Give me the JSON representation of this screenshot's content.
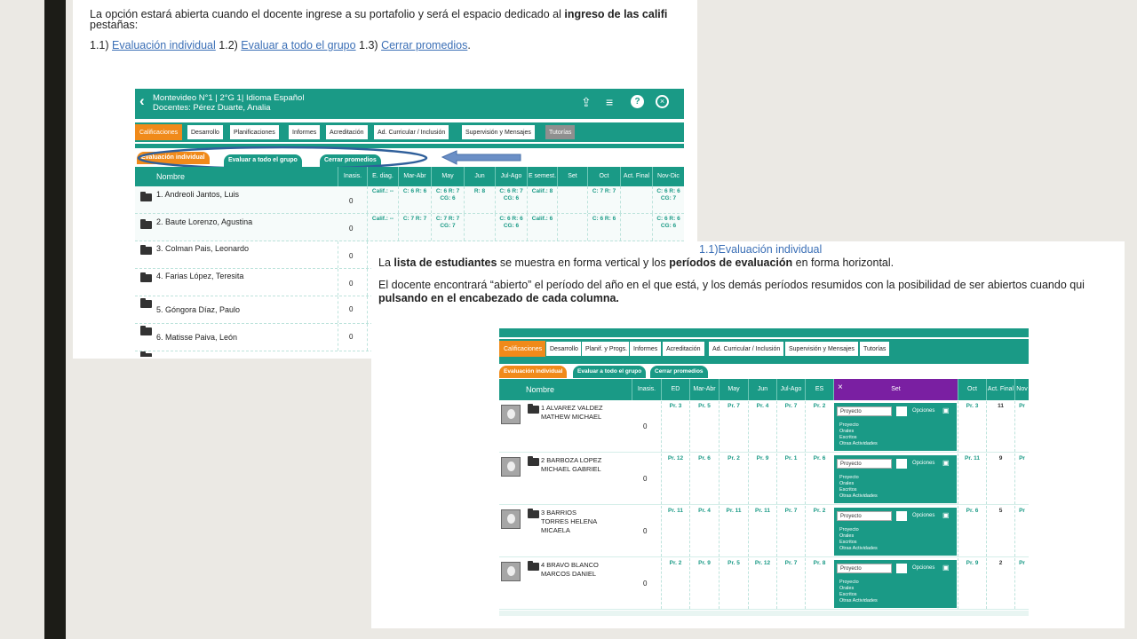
{
  "doc": {
    "line1_pre": "La opción estará abierta cuando el docente ingrese a su portafolio y será el espacio dedicado al ",
    "line1_bold": "ingreso de las califi",
    "line2": "pestañas:",
    "item1_num": "1.1)",
    "item1_link": "Evaluación individual",
    "item2_num": "1.2)",
    "item2_link": "Evaluar a todo el grupo",
    "item3_num": "1.3)",
    "item3_link": "Cerrar promedios",
    "item_end": "."
  },
  "app1": {
    "title_line1": "Montevideo N°1 | 2°G 1| Idioma Español",
    "title_line2": "Docentes: Pérez Duarte, Analia",
    "tabs": [
      "Calificaciones",
      "Desarrollo",
      "Planificaciones",
      "Informes",
      "Acreditación",
      "Ad. Curricular / Inclusión",
      "Supervisión y Mensajes",
      "Tutorías"
    ],
    "subtabs": [
      "Evaluación individual",
      "Evaluar a todo el grupo",
      "Cerrar promedios"
    ],
    "columns": [
      "Nombre",
      "Inasis.",
      "E. diag.",
      "Mar-Abr",
      "May",
      "Jun",
      "Jul-Ago",
      "E semest.",
      "Set",
      "Oct",
      "Act. Final",
      "Nov-Dic"
    ],
    "students": [
      {
        "name": "1. Andreoli Jantos, Luis",
        "inas": "0",
        "ediag": "Calif.: --",
        "marabr": "C: 6 R: 6",
        "may": "C: 6 R: 7 CG: 6",
        "jun": "R: 8",
        "julago": "C: 6 R: 7 CG: 6",
        "esem": "Calif.: 8",
        "set": "",
        "oct": "C: 7 R: 7",
        "act": "",
        "novdic": "C: 6 R: 6 CG: 7"
      },
      {
        "name": "2. Baute Lorenzo, Agustina",
        "inas": "0",
        "ediag": "Calif.: --",
        "marabr": "C: 7 R: 7",
        "may": "C: 7 R: 7 CG: 7",
        "jun": "",
        "julago": "C: 6 R: 6 CG: 6",
        "esem": "Calif.: 6",
        "set": "",
        "oct": "C: 6 R: 6",
        "act": "",
        "novdic": "C: 6 R: 6 CG: 6"
      },
      {
        "name": "3. Colman Pais, Leonardo",
        "inas": "0"
      },
      {
        "name": "4. Farias López, Teresita",
        "inas": "0"
      },
      {
        "name": "5. Góngora Díaz, Paulo",
        "inas": "0"
      },
      {
        "name": "6. Matisse Paiva, León",
        "inas": "0"
      }
    ]
  },
  "section2": {
    "heading": "1.1)Evaluación individual",
    "p1_a": "La ",
    "p1_b": "lista de estudiantes",
    "p1_c": " se muestra en forma vertical y los ",
    "p1_d": "períodos de evaluación",
    "p1_e": " en forma horizontal.",
    "p2_a": "El docente encontrará “abierto” el período del año en el que está, y los demás períodos resumidos con la posibilidad de ser abiertos cuando qui",
    "p2_b": "pulsando en el encabezado de cada columna."
  },
  "app2": {
    "tabs": [
      "Calificaciones",
      "Desarrollo",
      "Planif. y Progs.",
      "Informes",
      "Acreditación",
      "Ad. Curricular / Inclusión",
      "Supervisión y Mensajes",
      "Tutorías"
    ],
    "subtabs": [
      "Evaluación individual",
      "Evaluar a todo el grupo",
      "Cerrar promedios"
    ],
    "columns": [
      "Nombre",
      "Inasis.",
      "ED",
      "Mar-Abr",
      "May",
      "Jun",
      "Jul-Ago",
      "ES",
      "Set",
      "Oct",
      "Act. Final",
      "Nov"
    ],
    "close_x": "×",
    "set_select": "Proyecto",
    "set_options": "Opciones",
    "set_list": [
      "Proyecto",
      "Orales",
      "Escritos",
      "Otras Actividades"
    ],
    "students": [
      {
        "name": "1 ALVAREZ VALDEZ MATHEW MICHAEL",
        "inas": "0",
        "ed": "Pr. 3",
        "marabr": "Pr. 5",
        "may": "Pr. 7",
        "jun": "Pr. 4",
        "julago": "Pr. 7",
        "es": "Pr. 2",
        "oct": "Pr. 3",
        "act": "11",
        "nov": "Pr"
      },
      {
        "name": "2 BARBOZA LOPEZ MICHAEL GABRIEL",
        "inas": "0",
        "ed": "Pr. 12",
        "marabr": "Pr. 6",
        "may": "Pr. 2",
        "jun": "Pr. 9",
        "julago": "Pr. 1",
        "es": "Pr. 6",
        "oct": "Pr. 11",
        "act": "9",
        "nov": "Pr"
      },
      {
        "name": "3 BARRIOS TORRES HELENA MICAELA",
        "inas": "0",
        "ed": "Pr. 11",
        "marabr": "Pr. 4",
        "may": "Pr. 11",
        "jun": "Pr. 11",
        "julago": "Pr. 7",
        "es": "Pr. 2",
        "oct": "Pr. 6",
        "act": "5",
        "nov": "Pr"
      },
      {
        "name": "4 BRAVO BLANCO MARCOS DANIEL",
        "inas": "0",
        "ed": "Pr. 2",
        "marabr": "Pr. 9",
        "may": "Pr. 5",
        "jun": "Pr. 12",
        "julago": "Pr. 7",
        "es": "Pr. 8",
        "oct": "Pr. 9",
        "act": "2",
        "nov": "Pr"
      }
    ]
  },
  "colors": {
    "teal": "#1a9a86",
    "orange": "#f08a1a",
    "purple": "#7a1fa2",
    "link": "#3b6fb6",
    "arrow": "#6b8fc6",
    "ellipse": "#2f5f9a"
  },
  "icons": [
    "back-chevron-icon",
    "share-icon",
    "menu-icon",
    "help-icon",
    "close-icon",
    "folder-icon",
    "save-icon",
    "arrow-left-icon"
  ]
}
